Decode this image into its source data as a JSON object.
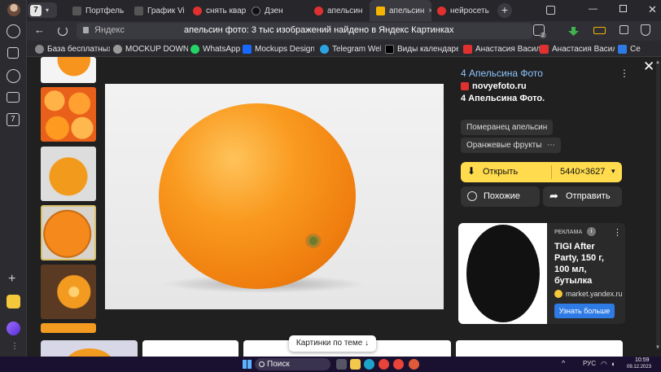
{
  "tabs": [
    {
      "label": "Портфель",
      "fav": "#555"
    },
    {
      "label": "График Vi",
      "fav": "#555"
    },
    {
      "label": "снять квар",
      "fav": "#e03030"
    },
    {
      "label": "Дзен",
      "fav": "#111"
    },
    {
      "label": "апельсин",
      "fav": "#e03030"
    },
    {
      "label": "апельсин",
      "fav": "#f5b400"
    },
    {
      "label": "нейросеть",
      "fav": "#e03030"
    }
  ],
  "tab_count": "7",
  "address": {
    "site": "Яндекс",
    "title": "апельсин фото: 3 тыс изображений найдено в Яндекс Картинках",
    "badge": "2"
  },
  "bookmarks": [
    "База бесплатных ф",
    "MOCKUP DOWNL",
    "WhatsApp",
    "Mockups Design o",
    "Telegram Web",
    "Виды календарей",
    "Анастасия Васил",
    "Анастасия Васил",
    "Се"
  ],
  "info": {
    "title": "4 Апельсина Фото",
    "site": "novyefoto.ru",
    "desc": "4 Апельсина Фото.",
    "tags": [
      "Померанец апельсин",
      "Оранжевые фрукты"
    ],
    "more": "⋯",
    "open": "Открыть",
    "size": "5440×3627",
    "similar": "Похожие",
    "share": "Отправить"
  },
  "ad": {
    "label": "РЕКЛАМА",
    "title": "TIGI After Party, 150 г, 100 мл, бутылка",
    "domain": "market.yandex.ru",
    "button": "Узнать больше"
  },
  "bottom": {
    "related": "Картинки по теме"
  },
  "taskbar": {
    "search": "Поиск",
    "lang": "РУС",
    "time": "10:59",
    "date": "09.12.2023"
  },
  "colors": {
    "accent": "#ffdb4d",
    "orange": "#f7941d",
    "ad_button": "#2f7be6"
  }
}
